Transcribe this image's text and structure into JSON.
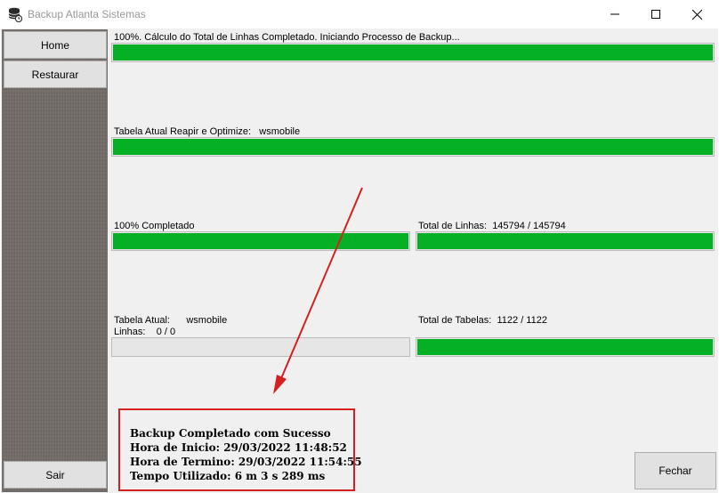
{
  "window": {
    "title": "Backup Atlanta Sistemas",
    "app_icon": "database-backup-icon",
    "controls": [
      "minimize-icon",
      "maximize-icon",
      "close-icon"
    ]
  },
  "sidebar": {
    "home_label": "Home",
    "restore_label": "Restaurar",
    "exit_label": "Sair"
  },
  "progress": {
    "total_lines_calc": {
      "text": "100%. Cálculo do Total de Linhas Completado. Iniciando Processo de Backup...",
      "value": 1.0
    },
    "repair_optimize": {
      "label": "Tabela Atual Reapir e Optimize:",
      "table": "wsmobile",
      "value": 1.0
    },
    "completed": {
      "text": "100% Completado",
      "value": 1.0
    },
    "total_lines": {
      "label": "Total de Linhas:",
      "value_text": "145794 / 145794",
      "value": 1.0
    },
    "current_table": {
      "label": "Tabela Atual:",
      "table": "wsmobile",
      "lines_label": "Linhas:",
      "lines_value": "0 / 0",
      "value": 0.0
    },
    "total_tables": {
      "label": "Total de Tabelas:",
      "value_text": "1122 / 1122",
      "value": 1.0
    }
  },
  "status": {
    "line1": "Backup Completado com Sucesso",
    "line2": "Hora de Inicio: 29/03/2022 11:48:52",
    "line3": "Hora de Termino: 29/03/2022 11:54:55",
    "line4": "Tempo Utilizado: 6 m 3 s 289 ms"
  },
  "close_button_label": "Fechar",
  "colors": {
    "progress_green": "#06b025",
    "annotation_red": "#d42020",
    "sidebar_texture": "#716a66"
  }
}
